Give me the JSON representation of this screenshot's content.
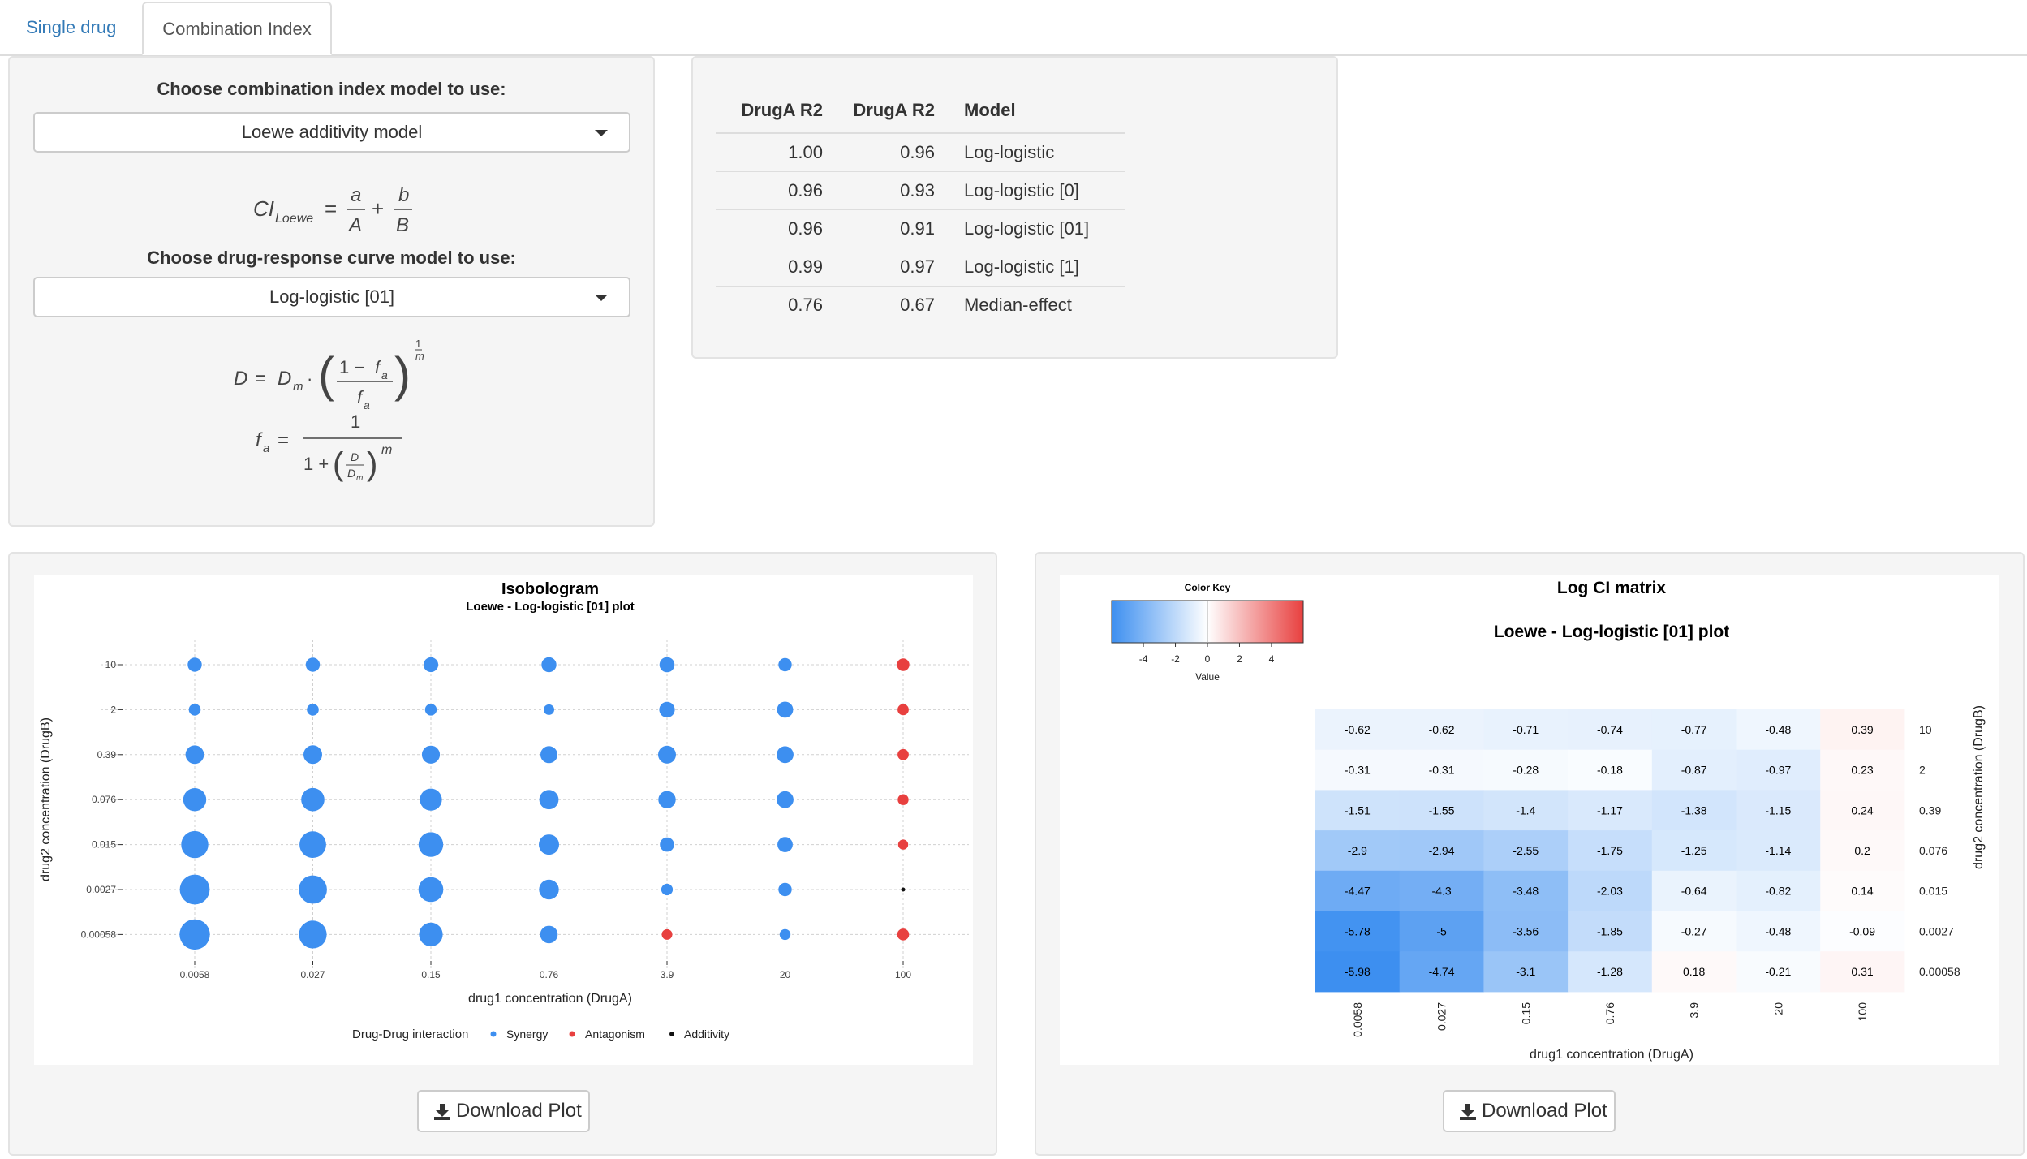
{
  "tabs": [
    {
      "label": "Single drug",
      "active": false
    },
    {
      "label": "Combination Index",
      "active": true
    }
  ],
  "model_panel": {
    "ci_model_label": "Choose combination index model to use:",
    "ci_model_value": "Loewe additivity model",
    "drc_model_label": "Choose drug-response curve model to use:",
    "drc_model_value": "Log-logistic [01]"
  },
  "r2_table": {
    "headers": [
      "DrugA R2",
      "DrugA R2",
      "Model"
    ],
    "rows": [
      [
        "1.00",
        "0.96",
        "Log-logistic"
      ],
      [
        "0.96",
        "0.93",
        "Log-logistic [0]"
      ],
      [
        "0.96",
        "0.91",
        "Log-logistic [01]"
      ],
      [
        "0.99",
        "0.97",
        "Log-logistic [1]"
      ],
      [
        "0.76",
        "0.67",
        "Median-effect"
      ]
    ]
  },
  "download_label": "Download Plot",
  "colors": {
    "synergy": "#3d8ff0",
    "antagonism": "#e8403f",
    "additivity": "#111111",
    "tab_link": "#337ab7"
  },
  "chart_data": [
    {
      "type": "scatter",
      "title": "Isobologram",
      "subtitle": "Loewe - Log-logistic [01] plot",
      "xlabel": "drug1 concentration (DrugA)",
      "ylabel": "drug2 concentration (DrugB)",
      "x_ticks": [
        "0.0058",
        "0.027",
        "0.15",
        "0.76",
        "3.9",
        "20",
        "100"
      ],
      "y_ticks": [
        "10",
        "2",
        "0.39",
        "0.076",
        "0.015",
        "0.0027",
        "0.00058"
      ],
      "legend_title": "Drug-Drug interaction",
      "legend": [
        "Synergy",
        "Antagonism",
        "Additivity"
      ],
      "legend_position": "bottom",
      "grid": true,
      "point_size_encoding": "abs(log CI)",
      "points_by_row": [
        [
          -0.62,
          -0.62,
          -0.71,
          -0.74,
          -0.77,
          -0.48,
          0.39
        ],
        [
          -0.31,
          -0.31,
          -0.28,
          -0.18,
          -0.87,
          -0.97,
          0.23
        ],
        [
          -1.51,
          -1.55,
          -1.4,
          -1.17,
          -1.38,
          -1.15,
          0.24
        ],
        [
          -2.9,
          -2.94,
          -2.55,
          -1.75,
          -1.25,
          -1.14,
          0.2
        ],
        [
          -4.47,
          -4.3,
          -3.48,
          -2.03,
          -0.64,
          -0.82,
          0.14
        ],
        [
          -5.78,
          -5,
          -3.56,
          -1.85,
          -0.27,
          -0.48,
          -0.09
        ],
        [
          -5.98,
          -4.74,
          -3.1,
          -1.28,
          0.18,
          -0.21,
          0.31
        ]
      ],
      "interaction_by_row": [
        [
          "Synergy",
          "Synergy",
          "Synergy",
          "Synergy",
          "Synergy",
          "Synergy",
          "Antagonism"
        ],
        [
          "Synergy",
          "Synergy",
          "Synergy",
          "Synergy",
          "Synergy",
          "Synergy",
          "Antagonism"
        ],
        [
          "Synergy",
          "Synergy",
          "Synergy",
          "Synergy",
          "Synergy",
          "Synergy",
          "Antagonism"
        ],
        [
          "Synergy",
          "Synergy",
          "Synergy",
          "Synergy",
          "Synergy",
          "Synergy",
          "Antagonism"
        ],
        [
          "Synergy",
          "Synergy",
          "Synergy",
          "Synergy",
          "Synergy",
          "Synergy",
          "Antagonism"
        ],
        [
          "Synergy",
          "Synergy",
          "Synergy",
          "Synergy",
          "Synergy",
          "Synergy",
          "Additivity"
        ],
        [
          "Synergy",
          "Synergy",
          "Synergy",
          "Synergy",
          "Antagonism",
          "Synergy",
          "Antagonism"
        ]
      ]
    },
    {
      "type": "heatmap",
      "title": "Log CI matrix",
      "subtitle": "Loewe - Log-logistic [01] plot",
      "xlabel": "drug1 concentration (DrugA)",
      "ylabel": "drug2 concentration (DrugB)",
      "x_ticks": [
        "0.0058",
        "0.027",
        "0.15",
        "0.76",
        "3.9",
        "20",
        "100"
      ],
      "y_ticks": [
        "10",
        "2",
        "0.39",
        "0.076",
        "0.015",
        "0.0027",
        "0.00058"
      ],
      "color_key": {
        "title": "Color Key",
        "label": "Value",
        "ticks": [
          "-4",
          "-2",
          "0",
          "2",
          "4"
        ],
        "range": [
          -5.98,
          5.98
        ],
        "low": "#3d8ff0",
        "mid": "#ffffff",
        "high": "#e8403f"
      },
      "values": [
        [
          "-0.62",
          "-0.62",
          "-0.71",
          "-0.74",
          "-0.77",
          "-0.48",
          "0.39"
        ],
        [
          "-0.31",
          "-0.31",
          "-0.28",
          "-0.18",
          "-0.87",
          "-0.97",
          "0.23"
        ],
        [
          "-1.51",
          "-1.55",
          "-1.4",
          "-1.17",
          "-1.38",
          "-1.15",
          "0.24"
        ],
        [
          "-2.9",
          "-2.94",
          "-2.55",
          "-1.75",
          "-1.25",
          "-1.14",
          "0.2"
        ],
        [
          "-4.47",
          "-4.3",
          "-3.48",
          "-2.03",
          "-0.64",
          "-0.82",
          "0.14"
        ],
        [
          "-5.78",
          "-5",
          "-3.56",
          "-1.85",
          "-0.27",
          "-0.48",
          "-0.09"
        ],
        [
          "-5.98",
          "-4.74",
          "-3.1",
          "-1.28",
          "0.18",
          "-0.21",
          "0.31"
        ]
      ]
    }
  ]
}
